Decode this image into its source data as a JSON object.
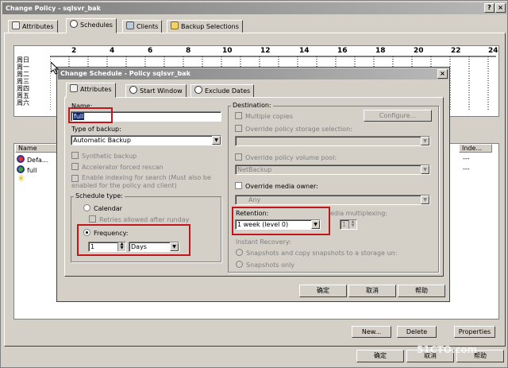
{
  "main": {
    "title": "Change Policy - sqlsvr_bak",
    "tabs": [
      "Attributes",
      "Schedules",
      "Clients",
      "Backup Selections"
    ],
    "hours": [
      "2",
      "4",
      "6",
      "8",
      "10",
      "12",
      "14",
      "16",
      "18",
      "20",
      "22",
      "24"
    ],
    "days": [
      "周日",
      "周一",
      "周二",
      "周三",
      "周四",
      "周五",
      "周六"
    ],
    "columns": {
      "name": "Name",
      "index": "Inde..."
    },
    "rows": [
      {
        "name": "Defa...",
        "index": "---"
      },
      {
        "name": "full",
        "index": "---"
      }
    ],
    "new_btn": "New...",
    "delete_btn": "Delete",
    "properties_btn": "Properties",
    "ok_btn": "确定",
    "cancel_btn": "取消",
    "help_btn": "帮助",
    "watermark": "51CTO.com"
  },
  "dialog": {
    "title": "Change Schedule - Policy sqlsvr_bak",
    "tabs": [
      "Attributes",
      "Start Window",
      "Exclude Dates"
    ],
    "name_label": "Name:",
    "name_value": "full",
    "type_label": "Type of backup:",
    "type_value": "Automatic Backup",
    "synthetic": "Synthetic backup",
    "accelerator": "Accelerator forced rescan",
    "indexing": "Enable indexing for search (Must also be enabled for the policy and client)",
    "schedule_type": "Schedule type:",
    "calendar": "Calendar",
    "retries": "Retries allowed after runday",
    "frequency": "Frequency:",
    "freq_value": "1",
    "freq_unit": "Days",
    "destination": "Destination:",
    "multiple_copies": "Multiple copies",
    "configure": "Configure...",
    "override_storage": "Override policy storage selection:",
    "override_pool": "Override policy volume pool:",
    "pool_value": "NetBackup",
    "override_media": "Override media owner:",
    "media_value": "Any",
    "retention": "Retention:",
    "retention_value": "1 week (level 0)",
    "media_multiplexing": "edia multiplexing:",
    "mux_value": "1",
    "instant_recovery": "Instant Recovery:",
    "snap_copy": "Snapshots and copy snapshots to a storage un:",
    "snap_only": "Snapshots only",
    "ok_btn": "确定",
    "cancel_btn": "取消",
    "help_btn": "帮助"
  }
}
